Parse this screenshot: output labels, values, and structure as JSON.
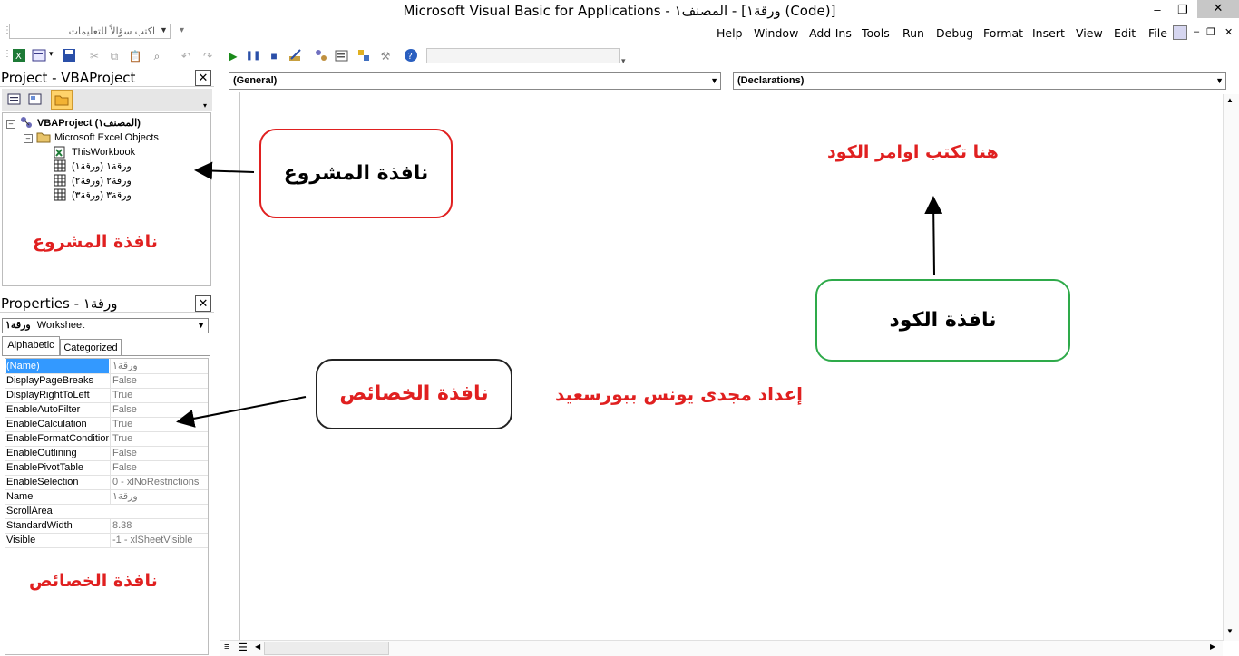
{
  "window": {
    "title": "Microsoft Visual Basic for Applications - المصنف١ - [ورقة١ (Code)]",
    "minimize_glyph": "–",
    "restore_glyph": "❐",
    "close_glyph": "✕"
  },
  "ask_box": {
    "placeholder": "اكتب سؤالاً للتعليمات"
  },
  "menu": {
    "items": [
      "Help",
      "Window",
      "Add-Ins",
      "Tools",
      "Run",
      "Debug",
      "Format",
      "Insert",
      "View",
      "Edit",
      "File"
    ],
    "mdi_min": "–",
    "mdi_restore": "❐",
    "mdi_close": "✕"
  },
  "project_pane": {
    "title": "Project - VBAProject",
    "close": "✕",
    "tree": {
      "root": "VBAProject (المصنف١)",
      "folder": "Microsoft Excel Objects",
      "items": [
        "ThisWorkbook",
        "ورقة١ (ورقة١)",
        "ورقة٢ (ورقة٢)",
        "ورقة٣ (ورقة٣)"
      ]
    }
  },
  "properties_pane": {
    "title": "Properties - ورقة١",
    "close": "✕",
    "object_name": "ورقة١",
    "object_type": "Worksheet",
    "tabs": [
      "Alphabetic",
      "Categorized"
    ],
    "rows": [
      {
        "name": "(Name)",
        "value": "ورقة١"
      },
      {
        "name": "DisplayPageBreaks",
        "value": "False"
      },
      {
        "name": "DisplayRightToLeft",
        "value": "True"
      },
      {
        "name": "EnableAutoFilter",
        "value": "False"
      },
      {
        "name": "EnableCalculation",
        "value": "True"
      },
      {
        "name": "EnableFormatConditionsCalculation",
        "value": "True"
      },
      {
        "name": "EnableOutlining",
        "value": "False"
      },
      {
        "name": "EnablePivotTable",
        "value": "False"
      },
      {
        "name": "EnableSelection",
        "value": "0 - xlNoRestrictions"
      },
      {
        "name": "Name",
        "value": "ورقة١"
      },
      {
        "name": "ScrollArea",
        "value": ""
      },
      {
        "name": "StandardWidth",
        "value": "8.38"
      },
      {
        "name": "Visible",
        "value": "-1 - xlSheetVisible"
      }
    ]
  },
  "code_window": {
    "object_combo": "(General)",
    "procedure_combo": "(Declarations)"
  },
  "annotations": {
    "project_callout": "نافذة المشروع",
    "project_note": "نافذة المشروع",
    "code_callout": "نافذة الكود",
    "code_note": "هنا تكتب اوامر الكود",
    "properties_callout": "نافذة الخصائص",
    "properties_note": "نافذة الخصائص",
    "author_note": "إعداد مجدى يونس ببورسعيد",
    "colors": {
      "red": "#e02020",
      "green": "#2eaa4a",
      "dark": "#222222"
    }
  }
}
